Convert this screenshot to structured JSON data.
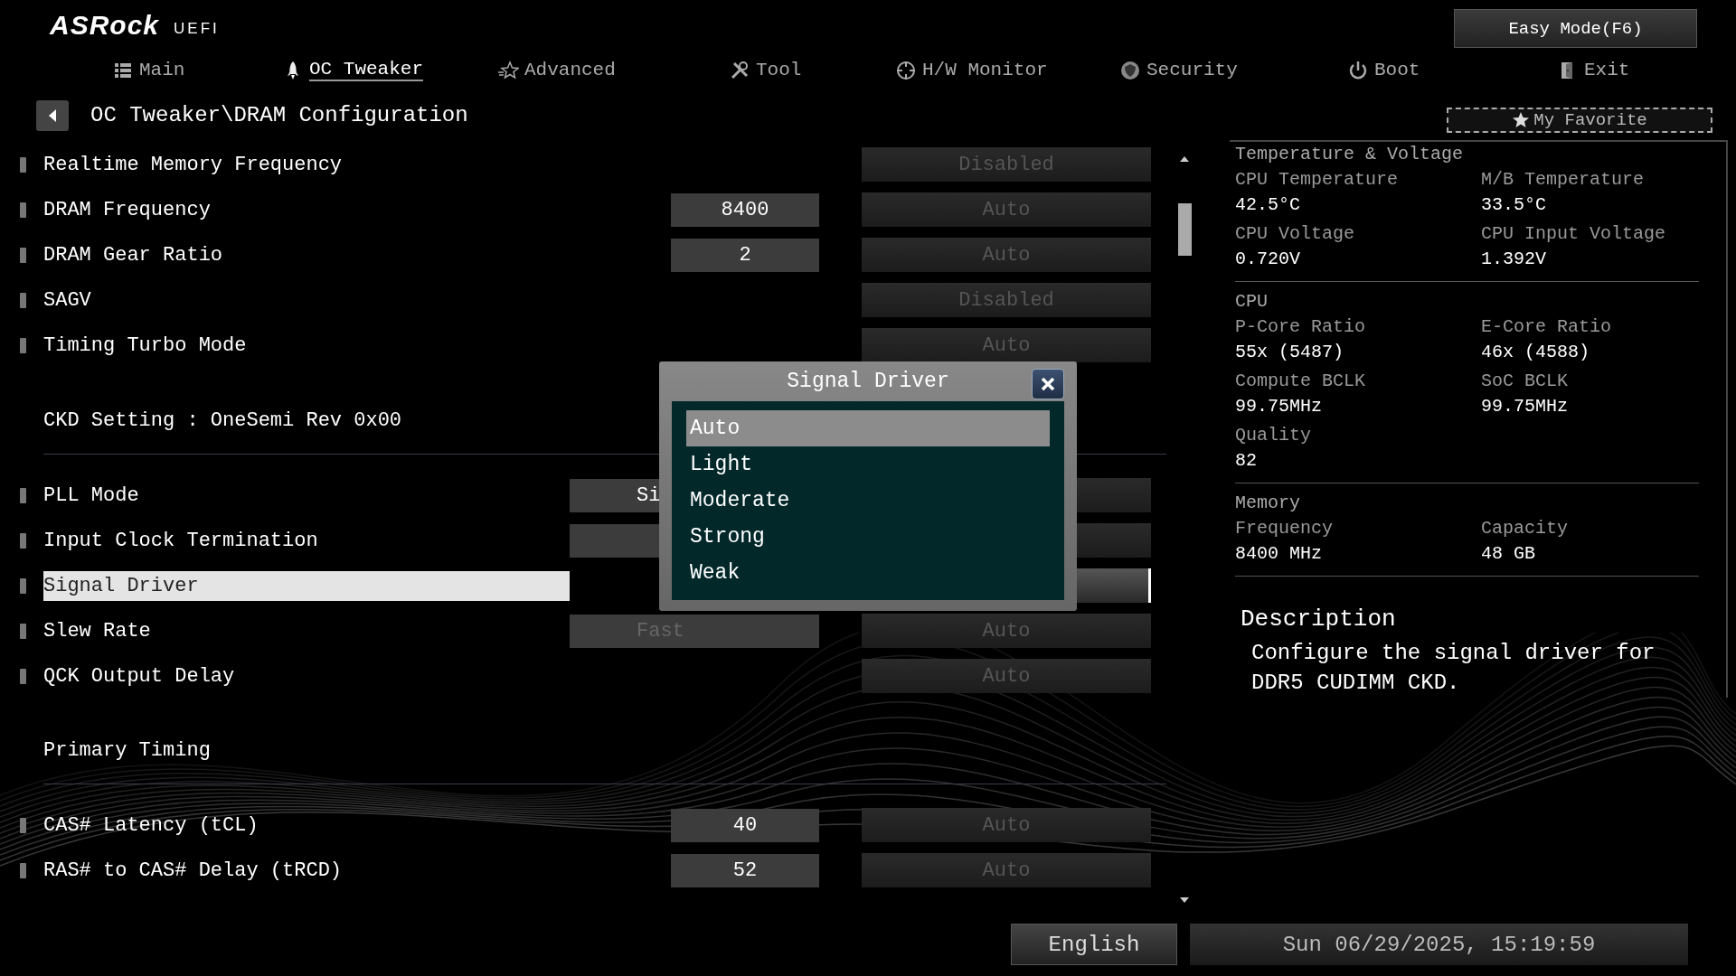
{
  "header": {
    "logo": "ASRock",
    "logo_suffix": "UEFI",
    "easy_mode": "Easy Mode(F6)"
  },
  "tabs": [
    {
      "label": "Main",
      "selected": false
    },
    {
      "label": "OC Tweaker",
      "selected": true
    },
    {
      "label": "Advanced",
      "selected": false
    },
    {
      "label": "Tool",
      "selected": false
    },
    {
      "label": "H/W Monitor",
      "selected": false
    },
    {
      "label": "Security",
      "selected": false
    },
    {
      "label": "Boot",
      "selected": false
    },
    {
      "label": "Exit",
      "selected": false
    }
  ],
  "breadcrumb": "OC Tweaker\\DRAM Configuration",
  "favorite": "My Favorite",
  "settings": [
    {
      "kind": "item",
      "label": "Realtime Memory Frequency",
      "option": "Disabled",
      "disabled": true,
      "selected": false
    },
    {
      "kind": "item",
      "label": "DRAM Frequency",
      "field": {
        "value": "8400",
        "wide": false,
        "disabled": false
      },
      "option": "Auto",
      "disabled": true,
      "selected": false
    },
    {
      "kind": "item",
      "label": "DRAM Gear Ratio",
      "field": {
        "value": "2",
        "wide": false,
        "disabled": false
      },
      "option": "Auto",
      "disabled": true,
      "selected": false
    },
    {
      "kind": "item",
      "label": "SAGV",
      "option": "Disabled",
      "disabled": true,
      "selected": false
    },
    {
      "kind": "item",
      "label": "Timing Turbo Mode",
      "option": "Auto",
      "disabled": true,
      "selected": false
    },
    {
      "kind": "section",
      "label": "CKD Setting : OneSemi Rev 0x00"
    },
    {
      "kind": "item",
      "label": "PLL Mode",
      "field": {
        "value": "Si",
        "wide": true,
        "disabled": false
      },
      "disabled": true,
      "selected": false
    },
    {
      "kind": "item",
      "label": "Input Clock Termination",
      "field": {
        "wide": true,
        "disabled": false
      },
      "disabled": true,
      "selected": false
    },
    {
      "kind": "item",
      "label": "Signal Driver",
      "disabled": true,
      "selected": true
    },
    {
      "kind": "item",
      "label": "Slew Rate",
      "field": {
        "value": "Fast",
        "wide": true,
        "disabled": true
      },
      "option": "Auto",
      "disabled": true,
      "selected": false
    },
    {
      "kind": "item",
      "label": "QCK Output Delay",
      "option": "Auto",
      "disabled": true,
      "selected": false
    },
    {
      "kind": "section",
      "label": "Primary Timing"
    },
    {
      "kind": "item",
      "label": "CAS# Latency (tCL)",
      "field": {
        "value": "40",
        "wide": false,
        "disabled": false
      },
      "option": "Auto",
      "disabled": true,
      "selected": false
    },
    {
      "kind": "item",
      "label": "RAS# to CAS# Delay (tRCD)",
      "field": {
        "value": "52",
        "wide": false,
        "disabled": false
      },
      "option": "Auto",
      "disabled": true,
      "selected": false
    }
  ],
  "dialog": {
    "title": "Signal Driver",
    "options": [
      {
        "label": "Auto",
        "selected": true
      },
      {
        "label": "Light",
        "selected": false
      },
      {
        "label": "Moderate",
        "selected": false
      },
      {
        "label": "Strong",
        "selected": false
      },
      {
        "label": "Weak",
        "selected": false
      }
    ]
  },
  "monitor": [
    {
      "title": "Temperature & Voltage",
      "items": [
        {
          "label": "CPU Temperature",
          "value": "42.5°C"
        },
        {
          "label": "M/B Temperature",
          "value": "33.5°C"
        },
        {
          "label": "CPU Voltage",
          "value": "0.720V"
        },
        {
          "label": "CPU Input Voltage",
          "value": "1.392V"
        }
      ]
    },
    {
      "title": "CPU",
      "items": [
        {
          "label": "P-Core Ratio",
          "value": "55x (5487)"
        },
        {
          "label": "E-Core Ratio",
          "value": "46x (4588)"
        },
        {
          "label": "Compute BCLK",
          "value": "99.75MHz"
        },
        {
          "label": "SoC BCLK",
          "value": "99.75MHz"
        },
        {
          "label": "Quality",
          "value": "82"
        }
      ]
    },
    {
      "title": "Memory",
      "items": [
        {
          "label": "Frequency",
          "value": "8400 MHz"
        },
        {
          "label": "Capacity",
          "value": "48 GB"
        }
      ]
    }
  ],
  "description": {
    "title": "Description",
    "text": "Configure the signal driver for DDR5 CUDIMM CKD."
  },
  "footer": {
    "language": "English",
    "datetime": "Sun 06/29/2025, 15:19:59"
  }
}
